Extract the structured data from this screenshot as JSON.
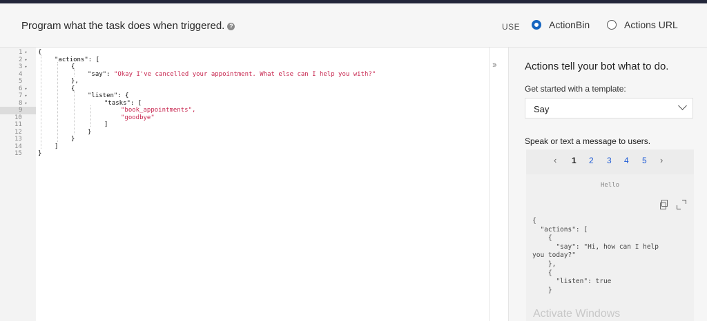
{
  "header": {
    "title": "Program what the task does when triggered.",
    "help_icon": "question-circle-icon",
    "use_label": "USE",
    "options": [
      {
        "label": "ActionBin",
        "checked": true
      },
      {
        "label": "Actions URL",
        "checked": false
      }
    ]
  },
  "editor": {
    "line_numbers": [
      "1",
      "2",
      "3",
      "4",
      "5",
      "6",
      "7",
      "8",
      "9",
      "10",
      "11",
      "12",
      "13",
      "14",
      "15"
    ],
    "active_line": 9,
    "code": {
      "l1": "{",
      "l2_key": "\"actions\": [",
      "l3": "{",
      "l4_key": "\"say\": ",
      "l4_val": "\"Okay I've cancelled your appointment. What else can I help you with?\"",
      "l5": "},",
      "l6": "{",
      "l7_key": "\"listen\": {",
      "l8_key": "\"tasks\": [",
      "l9_val": "\"book_appointments\",",
      "l10_val": "\"goodbye\"",
      "l11": "]",
      "l12": "}",
      "l13": "}",
      "l14": "]",
      "l15": "}"
    }
  },
  "expand_toggle": "››",
  "sidebar": {
    "heading": "Actions tell your bot what to do.",
    "template_label": "Get started with a template:",
    "template_selected": "Say",
    "description": "Speak or text a message to users.",
    "pager": {
      "prev": "‹",
      "pages": [
        "1",
        "2",
        "3",
        "4",
        "5"
      ],
      "current": "1",
      "next": "›"
    },
    "preview_label": "Hello",
    "preview_code": "{\n  \"actions\": [\n    {\n      \"say\": \"Hi, how can I help\nyou today?\"\n    },\n    {\n      \"listen\": true\n    }"
  },
  "watermark": "Activate Windows"
}
